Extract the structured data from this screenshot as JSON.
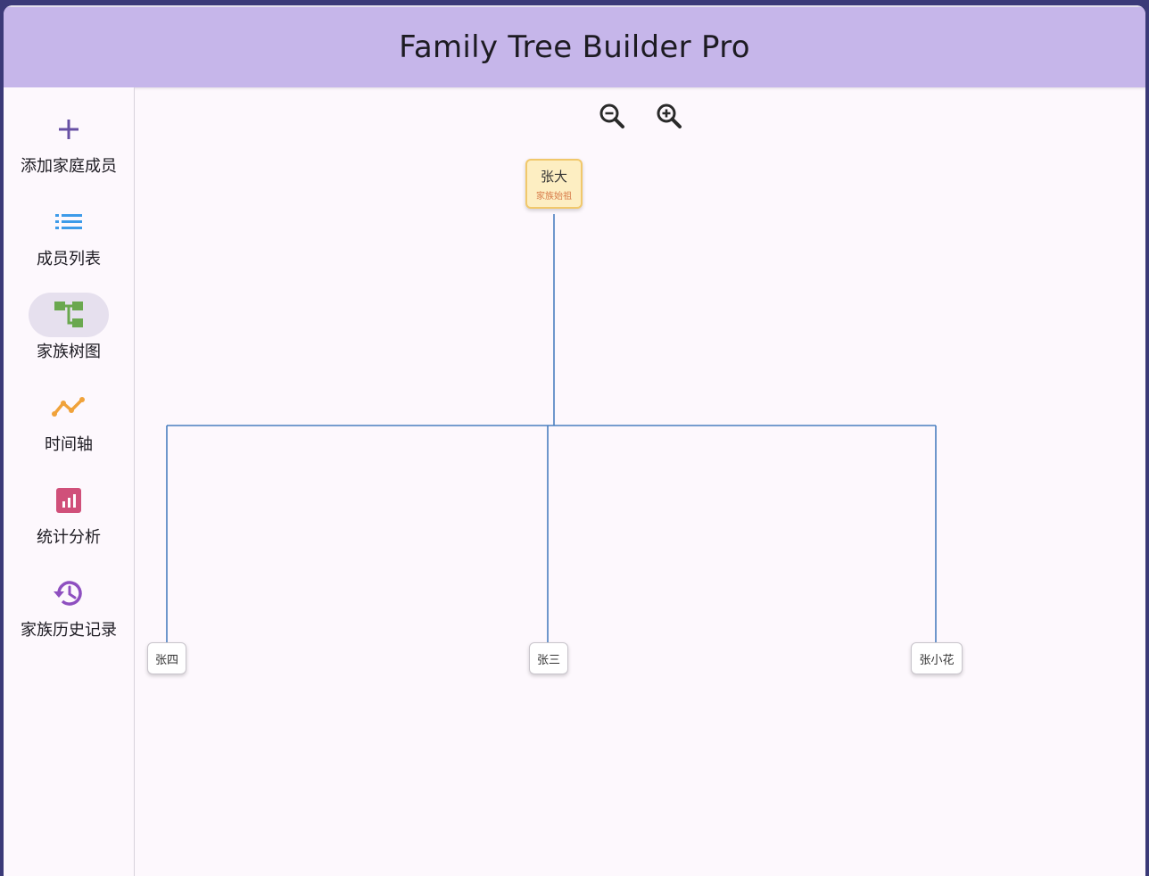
{
  "app": {
    "title": "Family Tree Builder Pro"
  },
  "nav": {
    "items": [
      {
        "label": "添加家庭成员",
        "icon": "add-icon",
        "color": "#6750a4"
      },
      {
        "label": "成员列表",
        "icon": "list-icon",
        "color": "#3d9be9"
      },
      {
        "label": "家族树图",
        "icon": "account-tree-icon",
        "color": "#6aa84f",
        "selected": true
      },
      {
        "label": "时间轴",
        "icon": "timeline-icon",
        "color": "#f0a23a"
      },
      {
        "label": "统计分析",
        "icon": "bar-chart-icon",
        "color": "#d0507a"
      },
      {
        "label": "家族历史记录",
        "icon": "history-icon",
        "color": "#8e4fc0"
      }
    ]
  },
  "toolbar": {
    "zoom_out_icon": "zoom-out-icon",
    "zoom_in_icon": "zoom-in-icon"
  },
  "tree": {
    "root": {
      "name": "张大",
      "tag": "家族始祖"
    },
    "children": [
      {
        "name": "张四"
      },
      {
        "name": "张三"
      },
      {
        "name": "张小花"
      }
    ]
  },
  "colors": {
    "header_bg": "#c6b6ea",
    "root_node_bg": "#fdeec2",
    "root_node_border": "#f1c86b",
    "tree_line": "#4a7fc0",
    "selected_pill": "#e6e0ee"
  }
}
